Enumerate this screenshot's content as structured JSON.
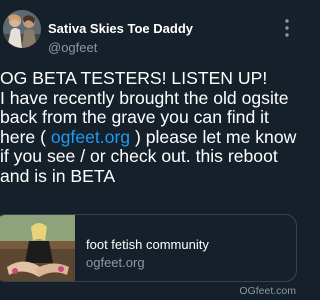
{
  "colors": {
    "background": "#15202b",
    "text": "#ffffff",
    "muted": "#8b98a5",
    "link": "#1d9bf0",
    "card_border": "#38444d"
  },
  "author": {
    "name": "Sativa Skies Toe Daddy",
    "handle": "@ogfeet",
    "avatar_icon": "profile-photo"
  },
  "header": {
    "more_icon": "more-vertical-icon"
  },
  "tweet": {
    "lines": [
      {
        "text": "OG BETA TESTERS! LISTEN UP!"
      },
      {
        "text": "I have recently brought the old ogsite"
      },
      {
        "text": "back from the grave you can find it"
      },
      {
        "before": "here ( ",
        "link": "ogfeet.org",
        "after": " ) please let me know"
      },
      {
        "text": "if you see / or check out. this reboot"
      },
      {
        "text": "and is in BETA"
      }
    ]
  },
  "link_card": {
    "title": "foot fetish community",
    "domain": "ogfeet.org",
    "thumbnail_icon": "card-thumbnail-photo"
  },
  "watermark": "OGfeet.com"
}
